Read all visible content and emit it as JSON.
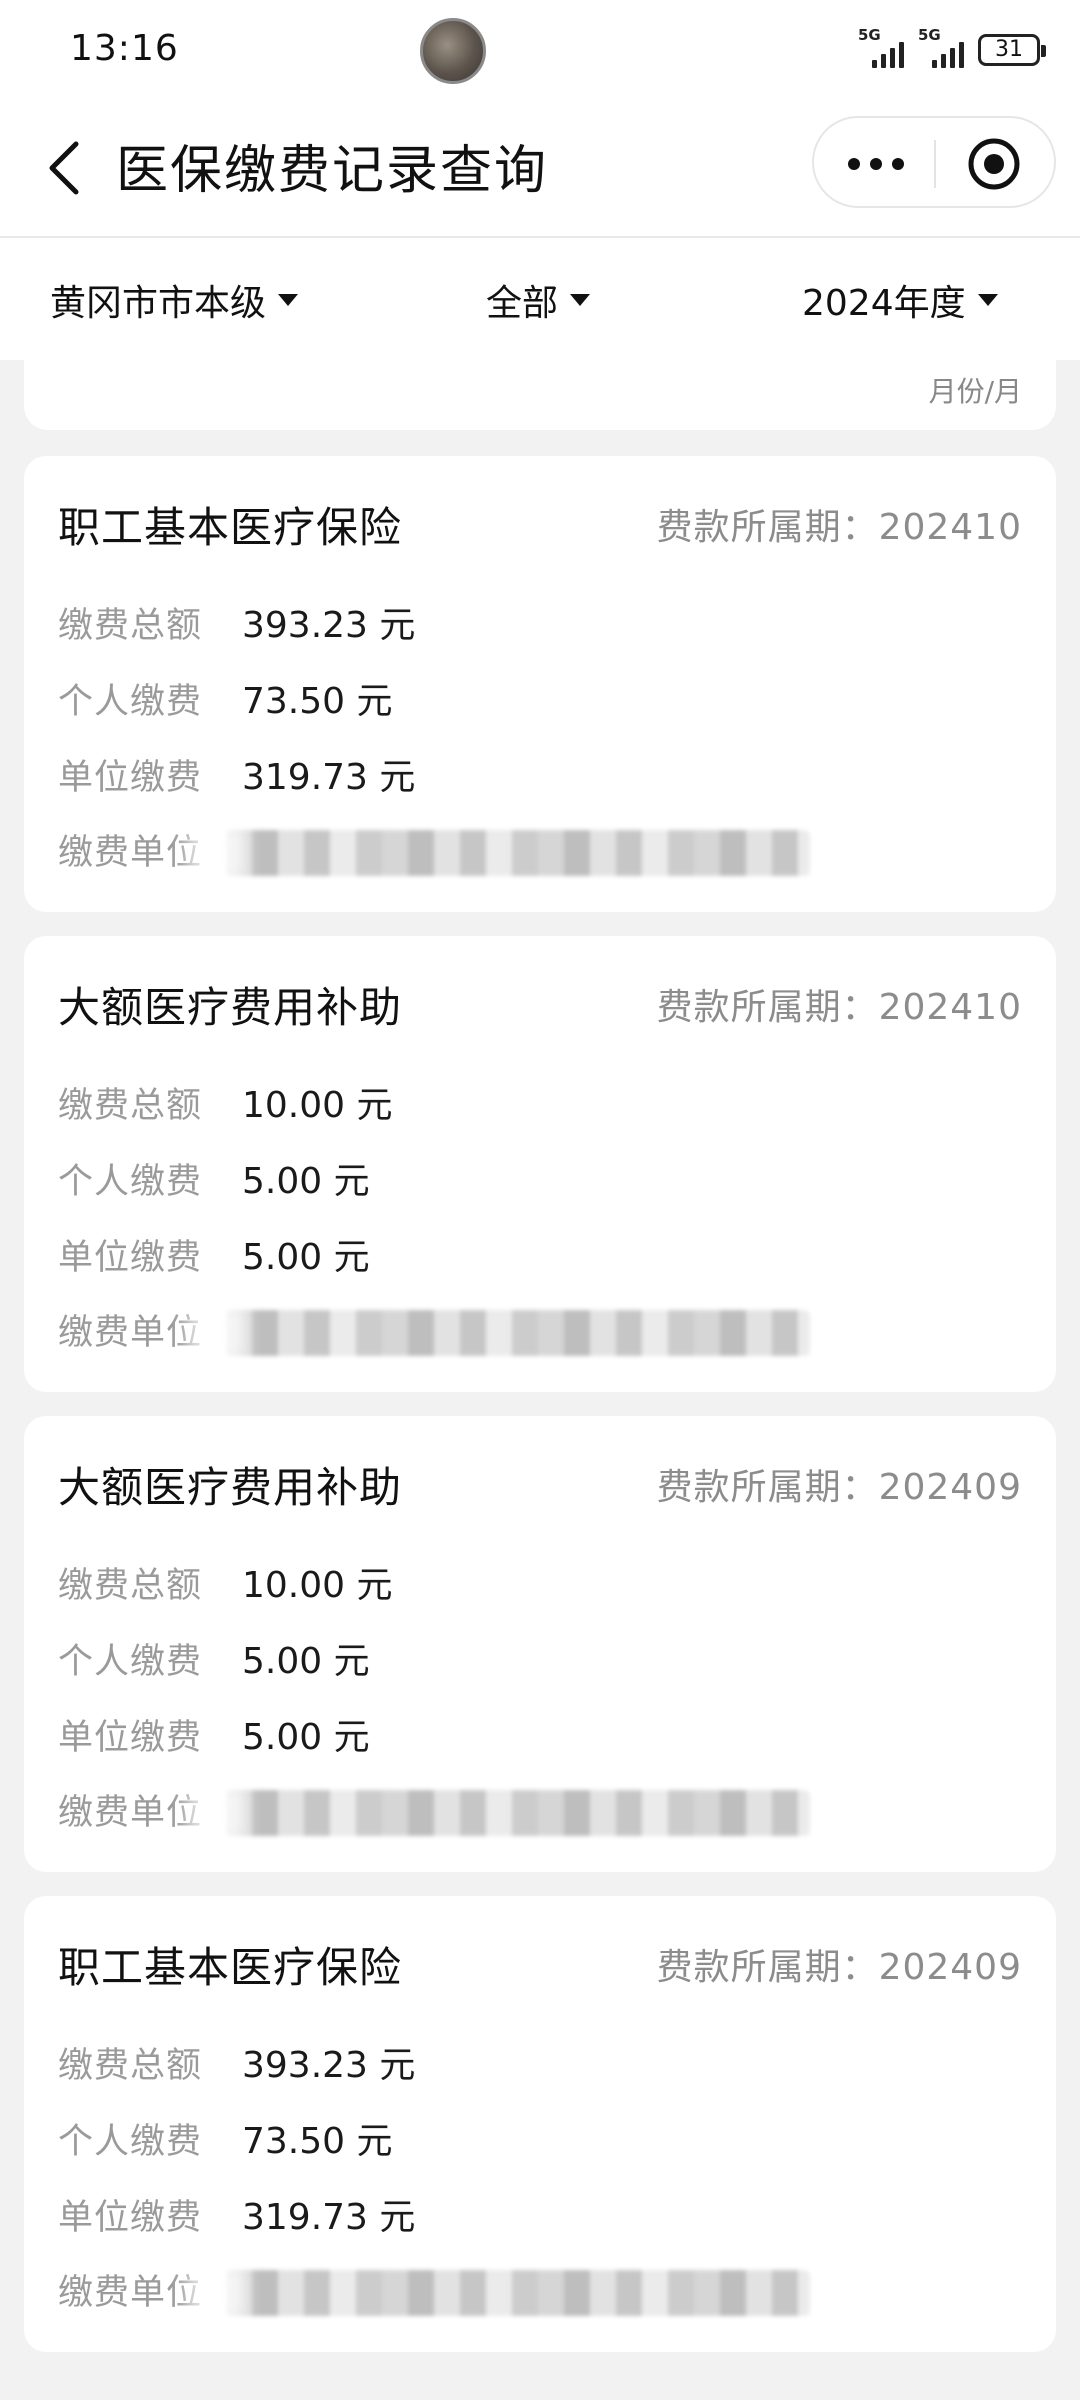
{
  "status_bar": {
    "time": "13:16",
    "signal_1": "5G",
    "signal_2": "5G",
    "battery": "31"
  },
  "nav": {
    "title": "医保缴费记录查询"
  },
  "filters": {
    "region": "黄冈市市本级",
    "type": "全部",
    "year": "2024年度"
  },
  "partial_card": {
    "unit_text": "月份/月"
  },
  "records": [
    {
      "title": "职工基本医疗保险",
      "period": "费款所属期：202410",
      "total_label": "缴费总额",
      "total_value": "393.23 元",
      "personal_label": "个人缴费",
      "personal_value": "73.50 元",
      "unit_label": "单位缴费",
      "unit_value": "319.73 元",
      "employer_label": "缴费单位"
    },
    {
      "title": "大额医疗费用补助",
      "period": "费款所属期：202410",
      "total_label": "缴费总额",
      "total_value": "10.00 元",
      "personal_label": "个人缴费",
      "personal_value": "5.00 元",
      "unit_label": "单位缴费",
      "unit_value": "5.00 元",
      "employer_label": "缴费单位"
    },
    {
      "title": "大额医疗费用补助",
      "period": "费款所属期：202409",
      "total_label": "缴费总额",
      "total_value": "10.00 元",
      "personal_label": "个人缴费",
      "personal_value": "5.00 元",
      "unit_label": "单位缴费",
      "unit_value": "5.00 元",
      "employer_label": "缴费单位"
    },
    {
      "title": "职工基本医疗保险",
      "period": "费款所属期：202409",
      "total_label": "缴费总额",
      "total_value": "393.23 元",
      "personal_label": "个人缴费",
      "personal_value": "73.50 元",
      "unit_label": "单位缴费",
      "unit_value": "319.73 元",
      "employer_label": "缴费单位"
    }
  ],
  "colors": {
    "background": "#f2f2f2",
    "card": "#ffffff",
    "label": "#9a9a9a",
    "period": "#8c8c8c",
    "text": "#1a1a1a"
  },
  "icons": [
    "back-arrow-icon",
    "more-dots-icon",
    "target-icon",
    "caret-down-icon",
    "battery-icon",
    "signal-icon"
  ]
}
